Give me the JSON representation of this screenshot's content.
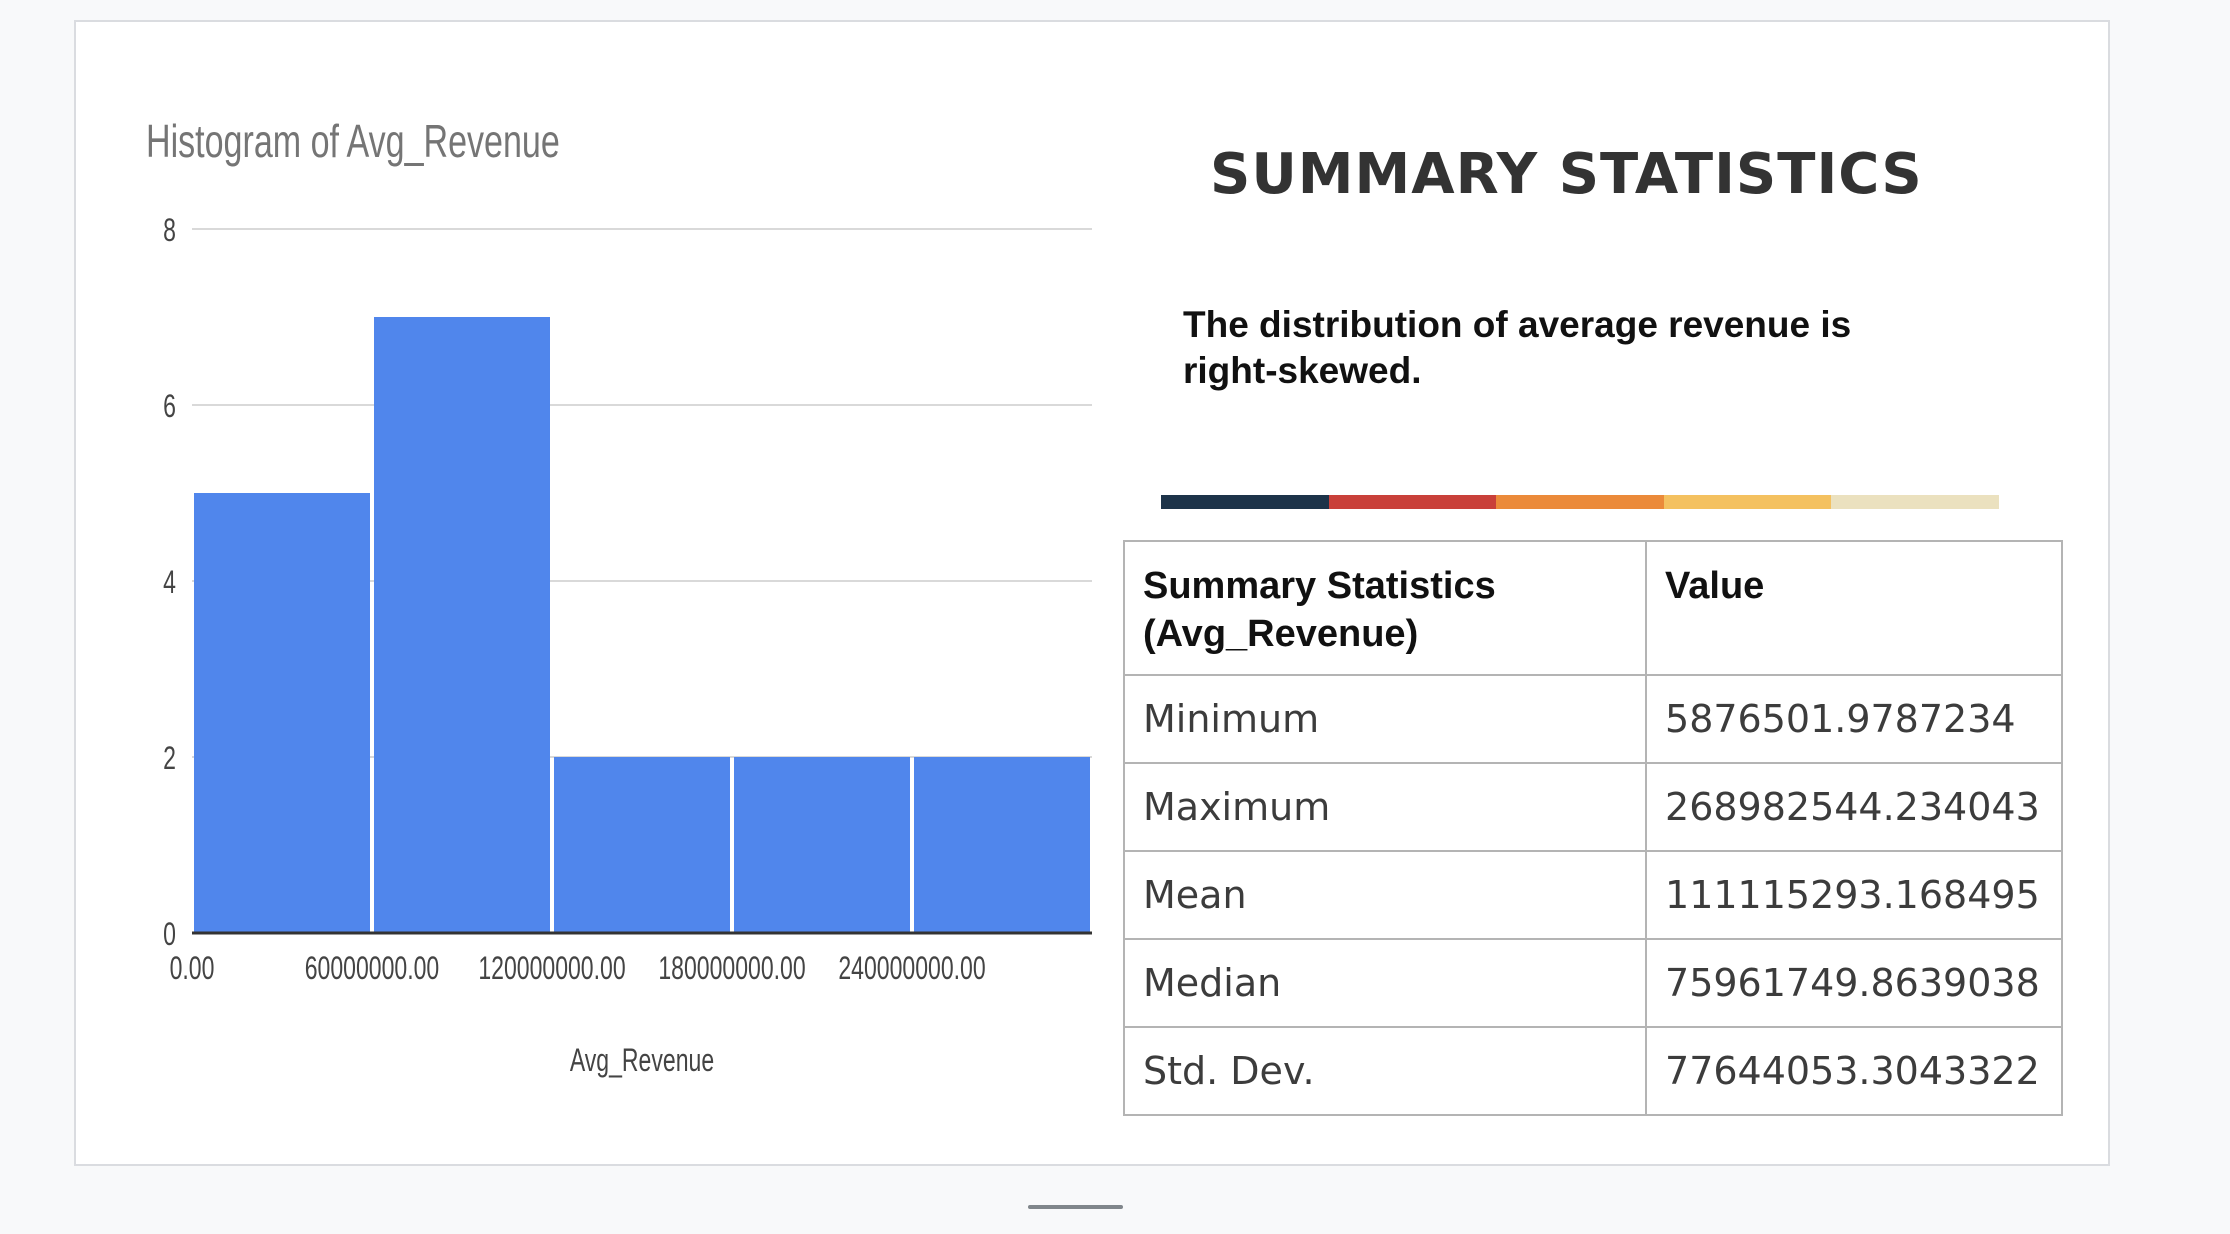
{
  "chart_data": {
    "type": "bar",
    "title": "Histogram of Avg_Revenue",
    "xlabel": "Avg_Revenue",
    "ylabel": "",
    "bins": [
      {
        "from": 0,
        "to": 60000000,
        "value": 5
      },
      {
        "from": 60000000,
        "to": 120000000,
        "value": 7
      },
      {
        "from": 120000000,
        "to": 180000000,
        "value": 2
      },
      {
        "from": 180000000,
        "to": 240000000,
        "value": 2
      },
      {
        "from": 240000000,
        "to": 300000000,
        "value": 2
      }
    ],
    "xticks": [
      "0.00",
      "60000000.00",
      "120000000.00",
      "180000000.00",
      "240000000.00"
    ],
    "yticks": [
      "0",
      "2",
      "4",
      "6",
      "8"
    ],
    "ylim": [
      0,
      8
    ],
    "xlim": [
      0,
      300000000
    ],
    "grid": true,
    "bar_color": "#5086ec"
  },
  "summary": {
    "title": "SUMMARY STATISTICS",
    "description": "The distribution of average revenue is right-skewed."
  },
  "color_bar": [
    "#1d3349",
    "#c9403a",
    "#eb8a3a",
    "#f4c160",
    "#ebe1bf"
  ],
  "table": {
    "headers": [
      "Summary Statistics (Avg_Revenue)",
      "Value"
    ],
    "rows": [
      [
        "Minimum",
        "5876501.9787234"
      ],
      [
        "Maximum",
        "268982544.234043"
      ],
      [
        "Mean",
        "111115293.168495"
      ],
      [
        "Median",
        "75961749.8639038"
      ],
      [
        "Std. Dev.",
        "77644053.3043322"
      ]
    ]
  }
}
